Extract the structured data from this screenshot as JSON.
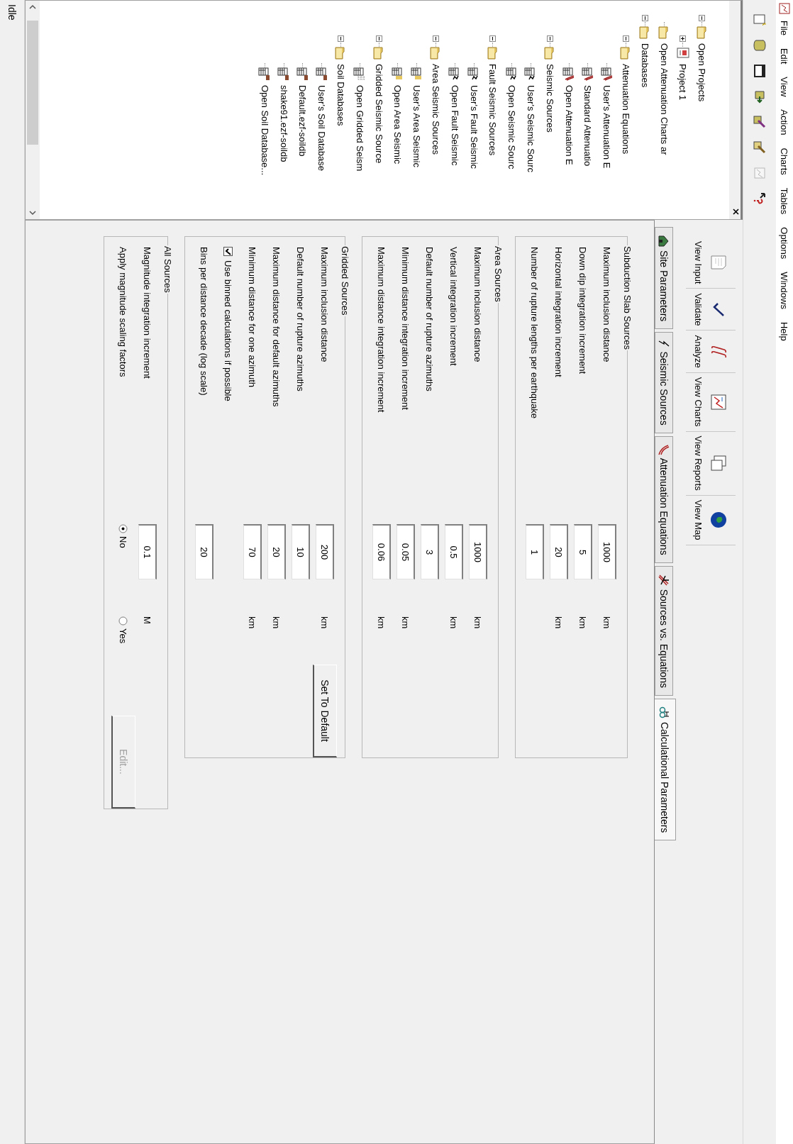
{
  "menu": [
    "File",
    "Edit",
    "View",
    "Action",
    "Charts",
    "Tables",
    "Options",
    "Windows",
    "Help"
  ],
  "tool_buttons": [
    {
      "kind": "new",
      "disabled": false
    },
    {
      "kind": "database",
      "disabled": false
    },
    {
      "kind": "window",
      "disabled": false
    },
    {
      "kind": "import",
      "disabled": false
    },
    {
      "kind": "edit",
      "disabled": false
    },
    {
      "kind": "edit2",
      "disabled": false
    },
    {
      "kind": "chart",
      "disabled": true
    },
    {
      "kind": "help",
      "disabled": false
    }
  ],
  "tree": [
    {
      "label": "Open Projects",
      "kind": "folder",
      "expanded": true,
      "children": [
        {
          "label": "Project 1",
          "kind": "project",
          "expanded": false
        }
      ]
    },
    {
      "label": "Open Attenuation Charts ar",
      "kind": "folder"
    },
    {
      "label": "Databases",
      "kind": "folder",
      "expanded": true,
      "children": [
        {
          "label": "Attenuation Equations",
          "kind": "folder",
          "expanded": true,
          "children": [
            {
              "label": "User's Attenuation E",
              "kind": "equation"
            },
            {
              "label": "Standard Attenuatio",
              "kind": "equation"
            },
            {
              "label": "Open Attenuation E",
              "kind": "equation"
            }
          ]
        },
        {
          "label": "Seismic Sources",
          "kind": "folder",
          "expanded": true,
          "children": [
            {
              "label": "User's Seismic Sourc",
              "kind": "source"
            },
            {
              "label": "Open Seismic Sourc",
              "kind": "source"
            }
          ]
        },
        {
          "label": "Fault Seismic Sources",
          "kind": "folder",
          "expanded": true,
          "children": [
            {
              "label": "User's Fault Seismic",
              "kind": "source"
            },
            {
              "label": "Open Fault Seismic",
              "kind": "source"
            }
          ]
        },
        {
          "label": "Area Seismic Sources",
          "kind": "folder",
          "expanded": true,
          "children": [
            {
              "label": "User's Area Seismic",
              "kind": "area"
            },
            {
              "label": "Open Area Seismic",
              "kind": "area"
            }
          ]
        },
        {
          "label": "Gridded Seismic Source",
          "kind": "folder",
          "expanded": true,
          "children": [
            {
              "label": "Open Gridded Seism",
              "kind": "gridded"
            }
          ]
        },
        {
          "label": "Soil Databases",
          "kind": "folder",
          "expanded": true,
          "children": [
            {
              "label": "User's Soil Database",
              "kind": "soil"
            },
            {
              "label": "Default.ezf-soildb",
              "kind": "soil"
            },
            {
              "label": "shake91.ezf-soildb",
              "kind": "soil"
            },
            {
              "label": "Open Soil Database...",
              "kind": "soil"
            }
          ]
        }
      ]
    }
  ],
  "command_buttons": [
    {
      "label": "View Input",
      "kind": "input"
    },
    {
      "label": "Validate",
      "kind": "validate"
    },
    {
      "label": "Analyze",
      "kind": "analyze"
    },
    {
      "label": "View Charts",
      "kind": "charts"
    },
    {
      "label": "View Reports",
      "kind": "reports"
    },
    {
      "label": "View Map",
      "kind": "map"
    }
  ],
  "tabs": [
    {
      "label": "Site Parameters",
      "kind": "site",
      "selected": false
    },
    {
      "label": "Seismic Sources",
      "kind": "seismic",
      "selected": false
    },
    {
      "label": "Attenuation Equations",
      "kind": "attenuation",
      "selected": false
    },
    {
      "label": "Sources vs. Equations",
      "kind": "versus",
      "selected": false
    },
    {
      "label": "Calculational Parameters",
      "kind": "calc",
      "selected": true
    }
  ],
  "groups": [
    {
      "title": "Subduction Slab Sources",
      "rows": [
        {
          "kind": "field",
          "label": "Maximum inclusion distance",
          "value": "1000",
          "unit": "km"
        },
        {
          "kind": "field",
          "label": "Down dip integration increment",
          "value": "5",
          "unit": "km"
        },
        {
          "kind": "field",
          "label": "Horizontal integration increment",
          "value": "20",
          "unit": "km"
        },
        {
          "kind": "field",
          "label": "Number of rupture lengths per earthquake",
          "value": "1"
        }
      ]
    },
    {
      "title": "Area Sources",
      "rows": [
        {
          "kind": "field",
          "label": "Maximum inclusion distance",
          "value": "1000",
          "unit": "km"
        },
        {
          "kind": "field",
          "label": "Vertical integration increment",
          "value": "0.5",
          "unit": "km"
        },
        {
          "kind": "field",
          "label": "Default number of rupture azimuths",
          "value": "3"
        },
        {
          "kind": "field",
          "label": "Minimum distance integration increment",
          "value": "0.05",
          "unit": "km"
        },
        {
          "kind": "field",
          "label": "Maximum distance integration increment",
          "value": "0.06",
          "unit": "km"
        }
      ]
    },
    {
      "title": "Gridded Sources",
      "rows": [
        {
          "kind": "field",
          "label": "Maximum inclusion distance",
          "value": "200",
          "unit": "km",
          "action": {
            "label": "Set To Default",
            "disabled": false
          }
        },
        {
          "kind": "field",
          "label": "Default number of rupture azimuths",
          "value": "10"
        },
        {
          "kind": "field",
          "label": "Maximum distance for default azimuths",
          "value": "20",
          "unit": "km"
        },
        {
          "kind": "field",
          "label": "Minimum distance for one azimuth",
          "value": "70",
          "unit": "km"
        },
        {
          "kind": "checkbox",
          "label": "Use binned calculations if possible",
          "checked": true
        },
        {
          "kind": "field",
          "label": "Bins per distance decade (log scale)",
          "value": "20"
        }
      ]
    },
    {
      "title": "All Sources",
      "rows": [
        {
          "kind": "field",
          "label": "Magnitude integration increment",
          "value": "0.1",
          "unit": "M"
        },
        {
          "kind": "radio",
          "label": "Apply magnitude scaling factors",
          "options": [
            {
              "label": "No",
              "selected": true
            },
            {
              "label": "Yes",
              "selected": false
            }
          ],
          "action": {
            "label": "Edit...",
            "disabled": true
          }
        }
      ]
    }
  ],
  "status": "Idle"
}
